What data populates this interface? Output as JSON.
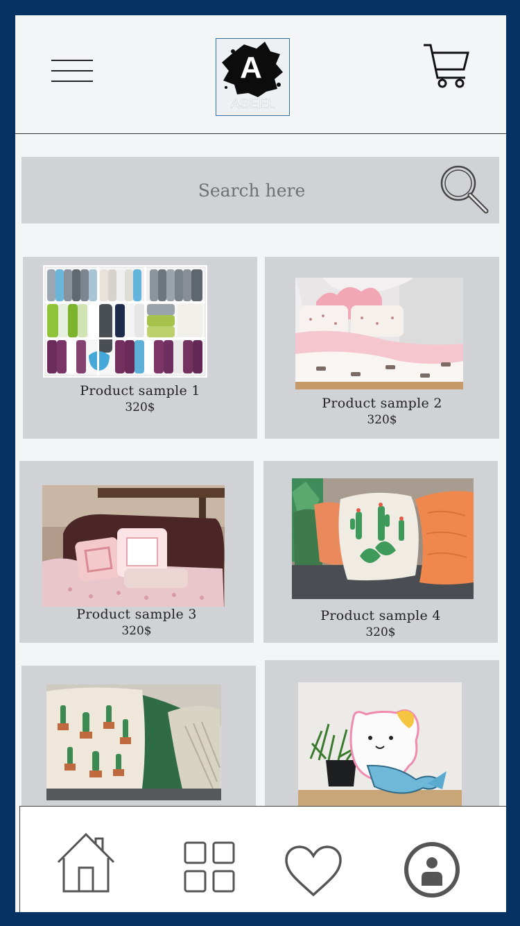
{
  "header": {
    "logo_letter": "A",
    "logo_text": "ASEEL",
    "menu_icon": "hamburger-menu-icon",
    "cart_icon": "shopping-cart-icon"
  },
  "search": {
    "placeholder": "Search here",
    "icon": "magnifier-icon"
  },
  "products": [
    {
      "title": "Product sample 1",
      "price": "320$",
      "image": "pillows-shelf-photo"
    },
    {
      "title": "Product sample 2",
      "price": "320$",
      "image": "pink-bedding-photo"
    },
    {
      "title": "Product sample 3",
      "price": "320$",
      "image": "pink-cushions-on-couch-photo"
    },
    {
      "title": "Product sample 4",
      "price": "320$",
      "image": "cactus-cushions-photo"
    },
    {
      "title": "",
      "price": "",
      "image": "cactus-pillow-photo"
    },
    {
      "title": "",
      "price": "",
      "image": "cat-mermaid-pillow-photo"
    }
  ],
  "bottom_nav": [
    {
      "icon": "home-icon"
    },
    {
      "icon": "grid-icon"
    },
    {
      "icon": "heart-icon"
    },
    {
      "icon": "profile-icon"
    }
  ],
  "colors": {
    "frame": "#053263",
    "background": "#f4f5f7",
    "card": "#d1d2d5",
    "icon_gray": "#555555"
  }
}
